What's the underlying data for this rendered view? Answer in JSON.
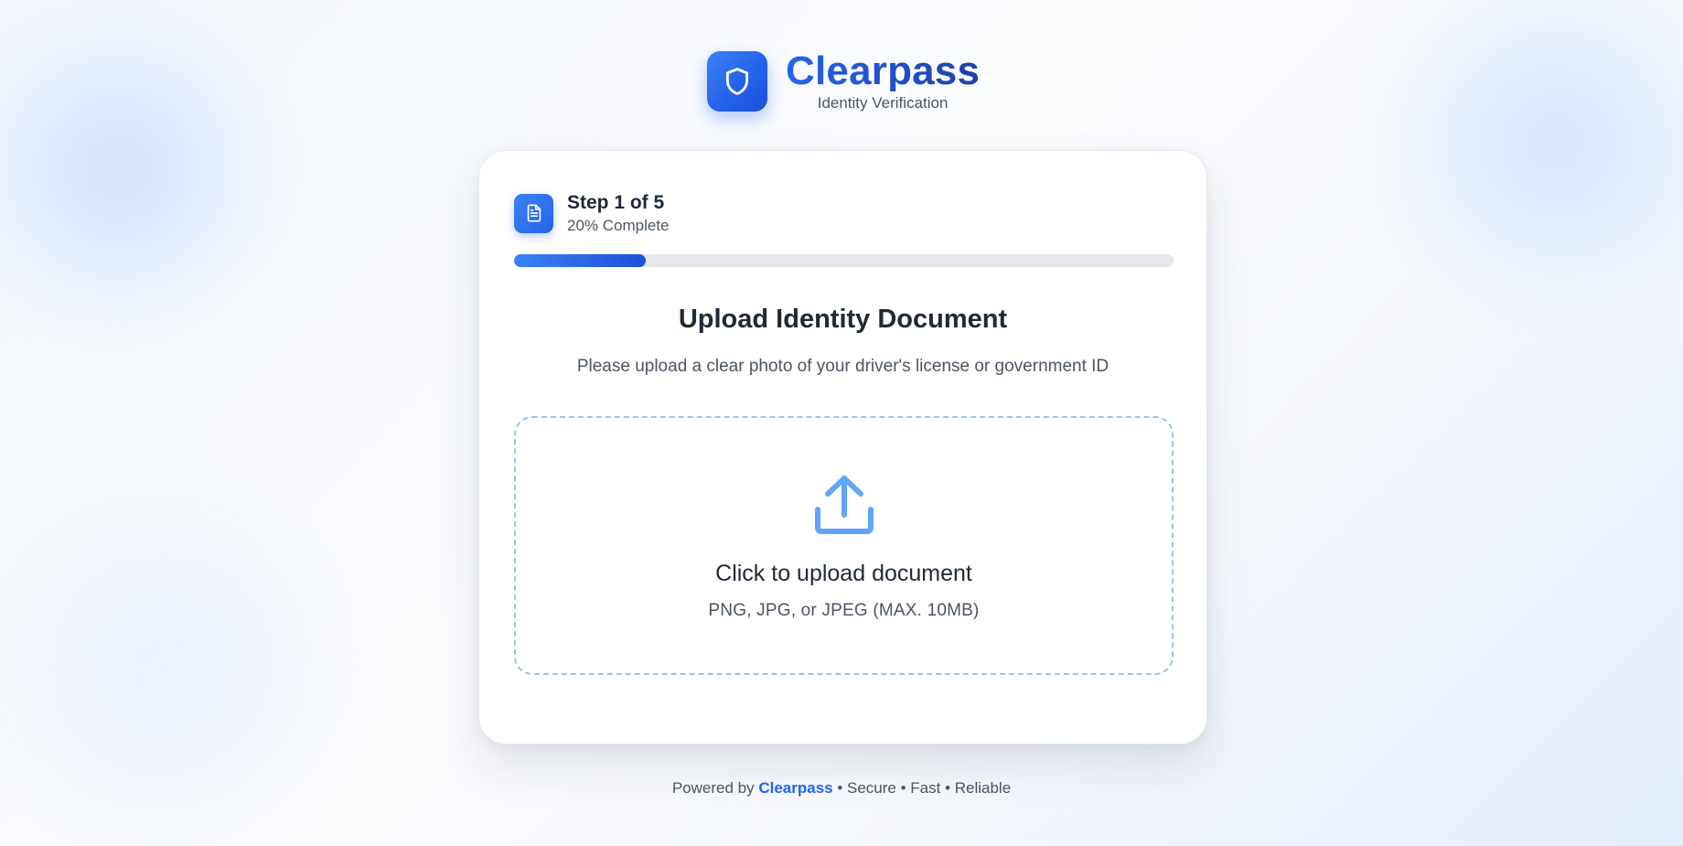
{
  "brand": {
    "name": "Clearpass",
    "subtitle": "Identity Verification",
    "logo_icon": "shield-icon",
    "accent_color": "#2563eb"
  },
  "step": {
    "icon": "document-icon",
    "title": "Step 1 of 5",
    "progress_text": "20% Complete",
    "progress_fraction": 0.2
  },
  "main": {
    "title": "Upload Identity Document",
    "description": "Please upload a clear photo of your driver's license or government ID"
  },
  "upload": {
    "icon": "upload-icon",
    "title": "Click to upload document",
    "formats": "PNG, JPG, or JPEG (MAX. 10MB)"
  },
  "footer": {
    "prefix": "Powered by",
    "brand": "Clearpass",
    "suffix": "• Secure • Fast • Reliable"
  }
}
